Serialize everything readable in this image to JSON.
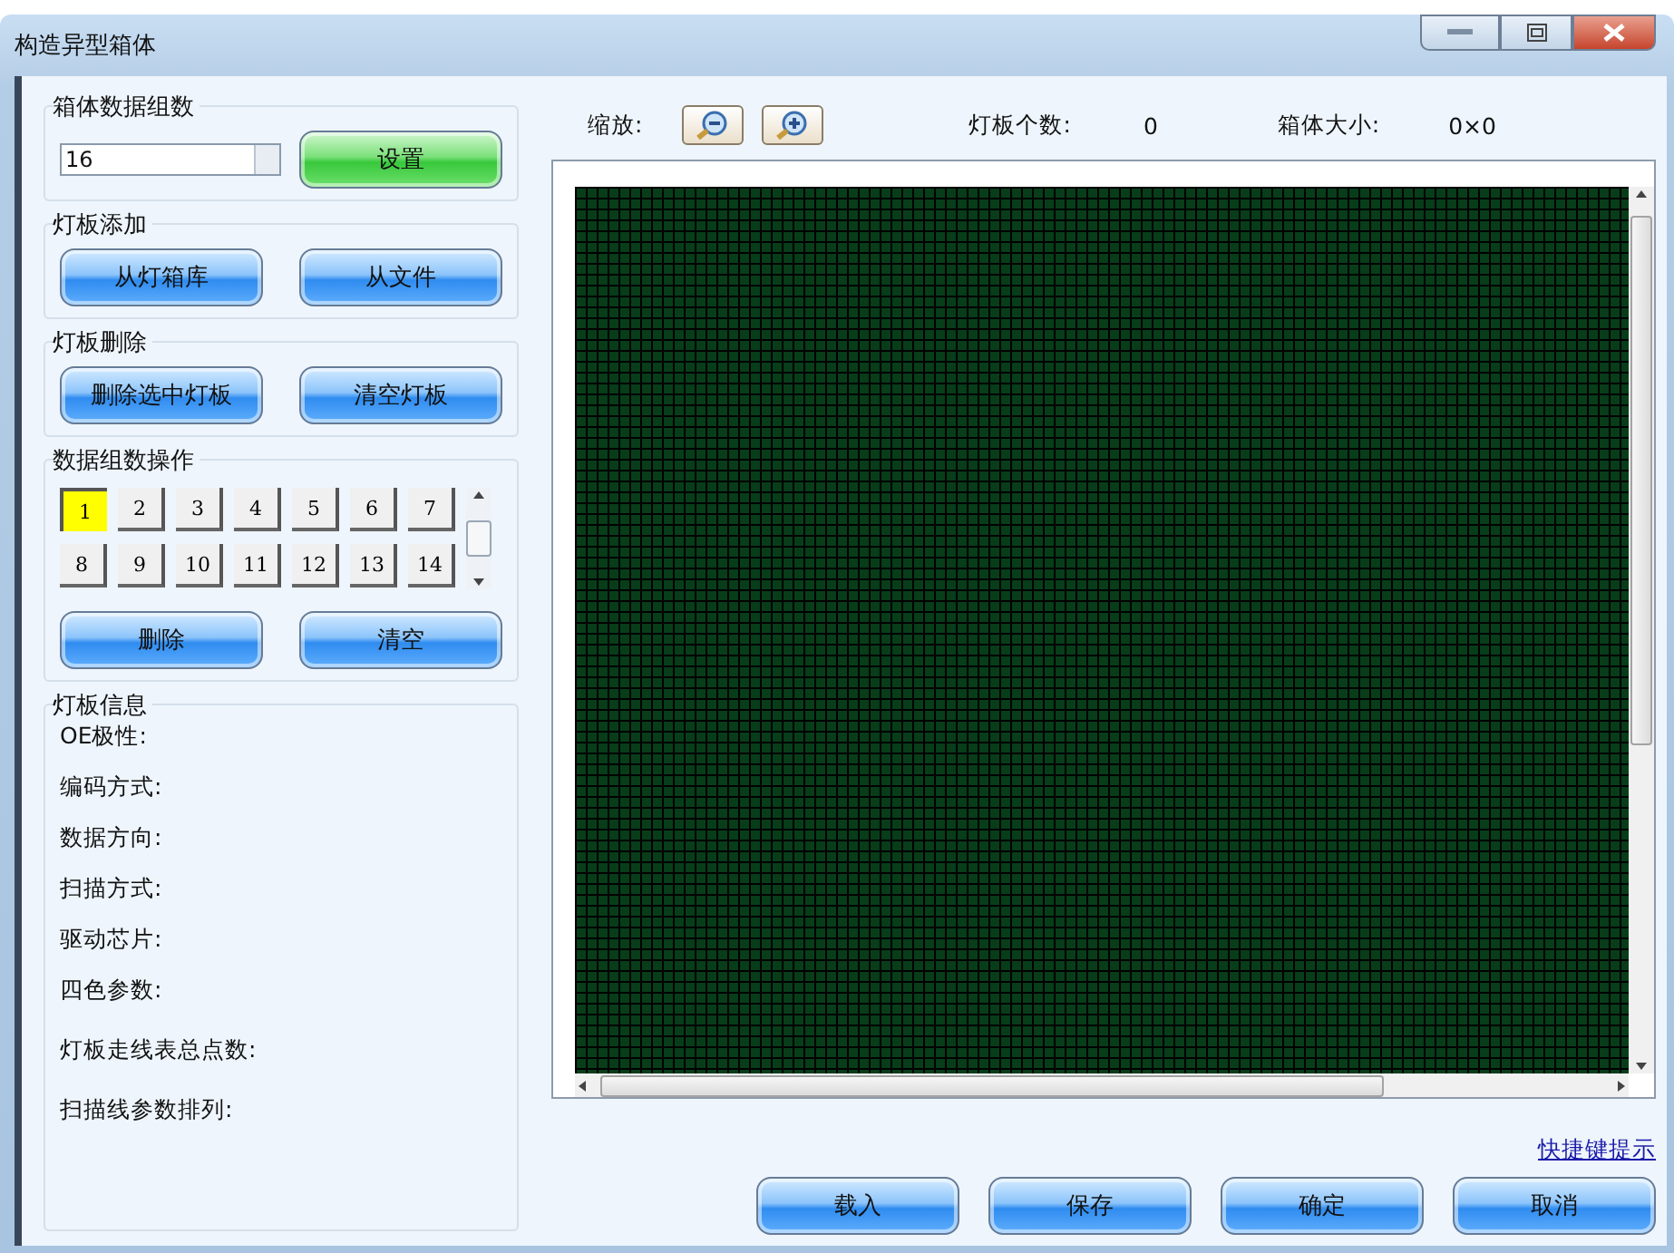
{
  "window": {
    "title": "构造异型箱体"
  },
  "data_groups": {
    "title": "箱体数据组数",
    "value": "16",
    "set_button": "设置"
  },
  "panel_add": {
    "title": "灯板添加",
    "buttons": [
      "从灯箱库",
      "从文件"
    ]
  },
  "panel_delete": {
    "title": "灯板删除",
    "buttons": [
      "删除选中灯板",
      "清空灯板"
    ]
  },
  "group_ops": {
    "title": "数据组数操作",
    "groups": [
      {
        "label": "1",
        "selected": true
      },
      {
        "label": "2",
        "selected": false
      },
      {
        "label": "3",
        "selected": false
      },
      {
        "label": "4",
        "selected": false
      },
      {
        "label": "5",
        "selected": false
      },
      {
        "label": "6",
        "selected": false
      },
      {
        "label": "7",
        "selected": false
      },
      {
        "label": "8",
        "selected": false
      },
      {
        "label": "9",
        "selected": false
      },
      {
        "label": "10",
        "selected": false
      },
      {
        "label": "11",
        "selected": false
      },
      {
        "label": "12",
        "selected": false
      },
      {
        "label": "13",
        "selected": false
      },
      {
        "label": "14",
        "selected": false
      }
    ],
    "buttons": [
      "删除",
      "清空"
    ]
  },
  "panel_info": {
    "title": "灯板信息",
    "fields": [
      "OE极性:",
      "编码方式:",
      "数据方向:",
      "扫描方式:",
      "驱动芯片:",
      "四色参数:",
      "灯板走线表总点数:",
      "扫描线参数排列:"
    ]
  },
  "toolbar": {
    "zoom_label": "缩放:",
    "count_label": "灯板个数:",
    "count": "0",
    "size_label": "箱体大小:",
    "size": "0×0"
  },
  "shortcut_link": "快捷键提示",
  "buttons": [
    "载入",
    "保存",
    "确定",
    "取消"
  ]
}
